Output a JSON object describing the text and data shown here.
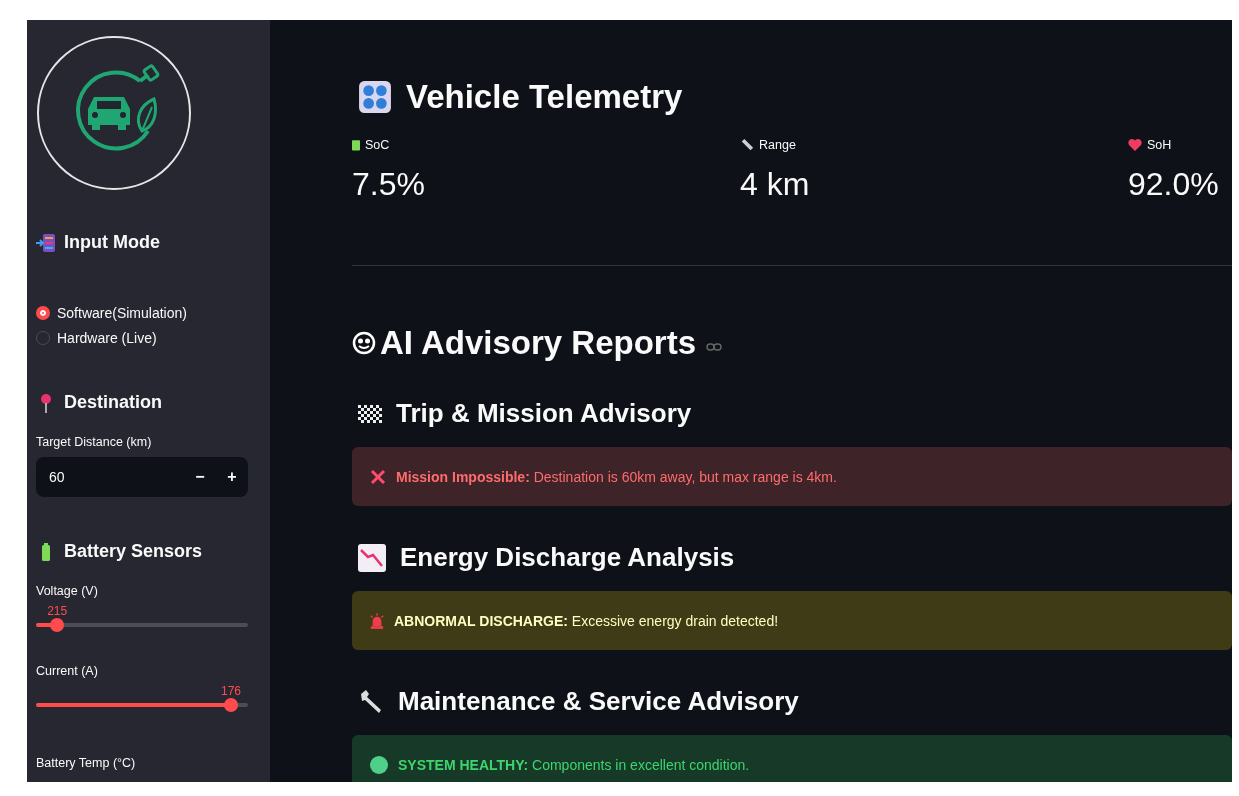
{
  "sidebar": {
    "input_mode": {
      "title": "Input Mode",
      "options": [
        {
          "label": "Software(Simulation)",
          "selected": true
        },
        {
          "label": "Hardware (Live)",
          "selected": false
        }
      ]
    },
    "destination": {
      "title": "Destination",
      "field_label": "Target Distance (km)",
      "value": "60",
      "decrement": "−",
      "increment": "+"
    },
    "battery_sensors": {
      "title": "Battery Sensors",
      "sliders": [
        {
          "label": "Voltage (V)",
          "reading": "215",
          "level": 0.1
        },
        {
          "label": "Current (A)",
          "reading": "176",
          "level": 0.92
        }
      ],
      "next_label": "Battery Temp (°C)"
    }
  },
  "main": {
    "title": "Vehicle Telemetry",
    "metrics": [
      {
        "kind": "battery",
        "label": "SoC",
        "value": "7.5%"
      },
      {
        "kind": "ruler",
        "label": "Range",
        "value": "4 km"
      },
      {
        "kind": "heart",
        "label": "SoH",
        "value": "92.0%"
      }
    ],
    "advisory_title": "AI Advisory Reports",
    "sections": [
      {
        "kind": "flag",
        "title": "Trip & Mission Advisory",
        "alert": {
          "kind": "error",
          "text": "**Mission Impossible:** Destination is 60km away, but max range is 4km."
        }
      },
      {
        "kind": "chart",
        "title": "Energy Discharge Analysis",
        "alert": {
          "kind": "warning",
          "text": "**ABNORMAL DISCHARGE:** Excessive energy drain detected!"
        }
      },
      {
        "kind": "wrench",
        "title": "Maintenance & Service Advisory",
        "alert": {
          "kind": "success",
          "text": "**SYSTEM HEALTHY:** Components in excellent condition."
        }
      }
    ]
  }
}
